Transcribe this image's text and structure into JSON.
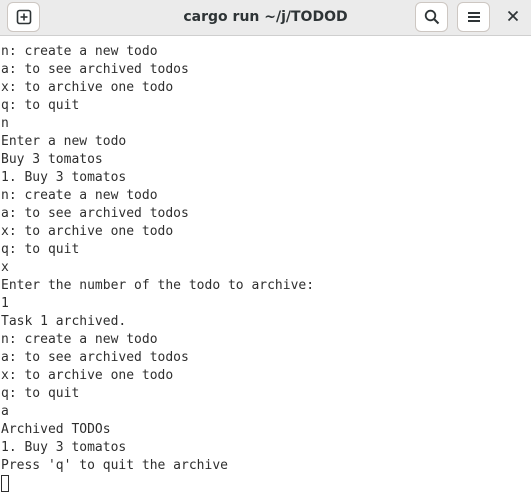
{
  "window": {
    "title": "cargo run ~/j/TODOD"
  },
  "headerbar": {
    "new_tab_icon": "plus-square-icon",
    "search_icon": "search-icon",
    "menu_icon": "hamburger-menu-icon",
    "close_icon": "close-icon"
  },
  "terminal": {
    "lines": [
      "n: create a new todo",
      "a: to see archived todos",
      "x: to archive one todo",
      "q: to quit",
      "n",
      "Enter a new todo",
      "Buy 3 tomatos",
      "1. Buy 3 tomatos",
      "n: create a new todo",
      "a: to see archived todos",
      "x: to archive one todo",
      "q: to quit",
      "x",
      "Enter the number of the todo to archive:",
      "1",
      "Task 1 archived.",
      "n: create a new todo",
      "a: to see archived todos",
      "x: to archive one todo",
      "q: to quit",
      "a",
      "Archived TODOs",
      "1. Buy 3 tomatos",
      "Press 'q' to quit the archive"
    ]
  },
  "colors": {
    "headerbar_bg": "#ebebeb",
    "terminal_bg": "#ffffff",
    "terminal_fg": "#2e2e2e",
    "title_fg": "#2e3436"
  }
}
